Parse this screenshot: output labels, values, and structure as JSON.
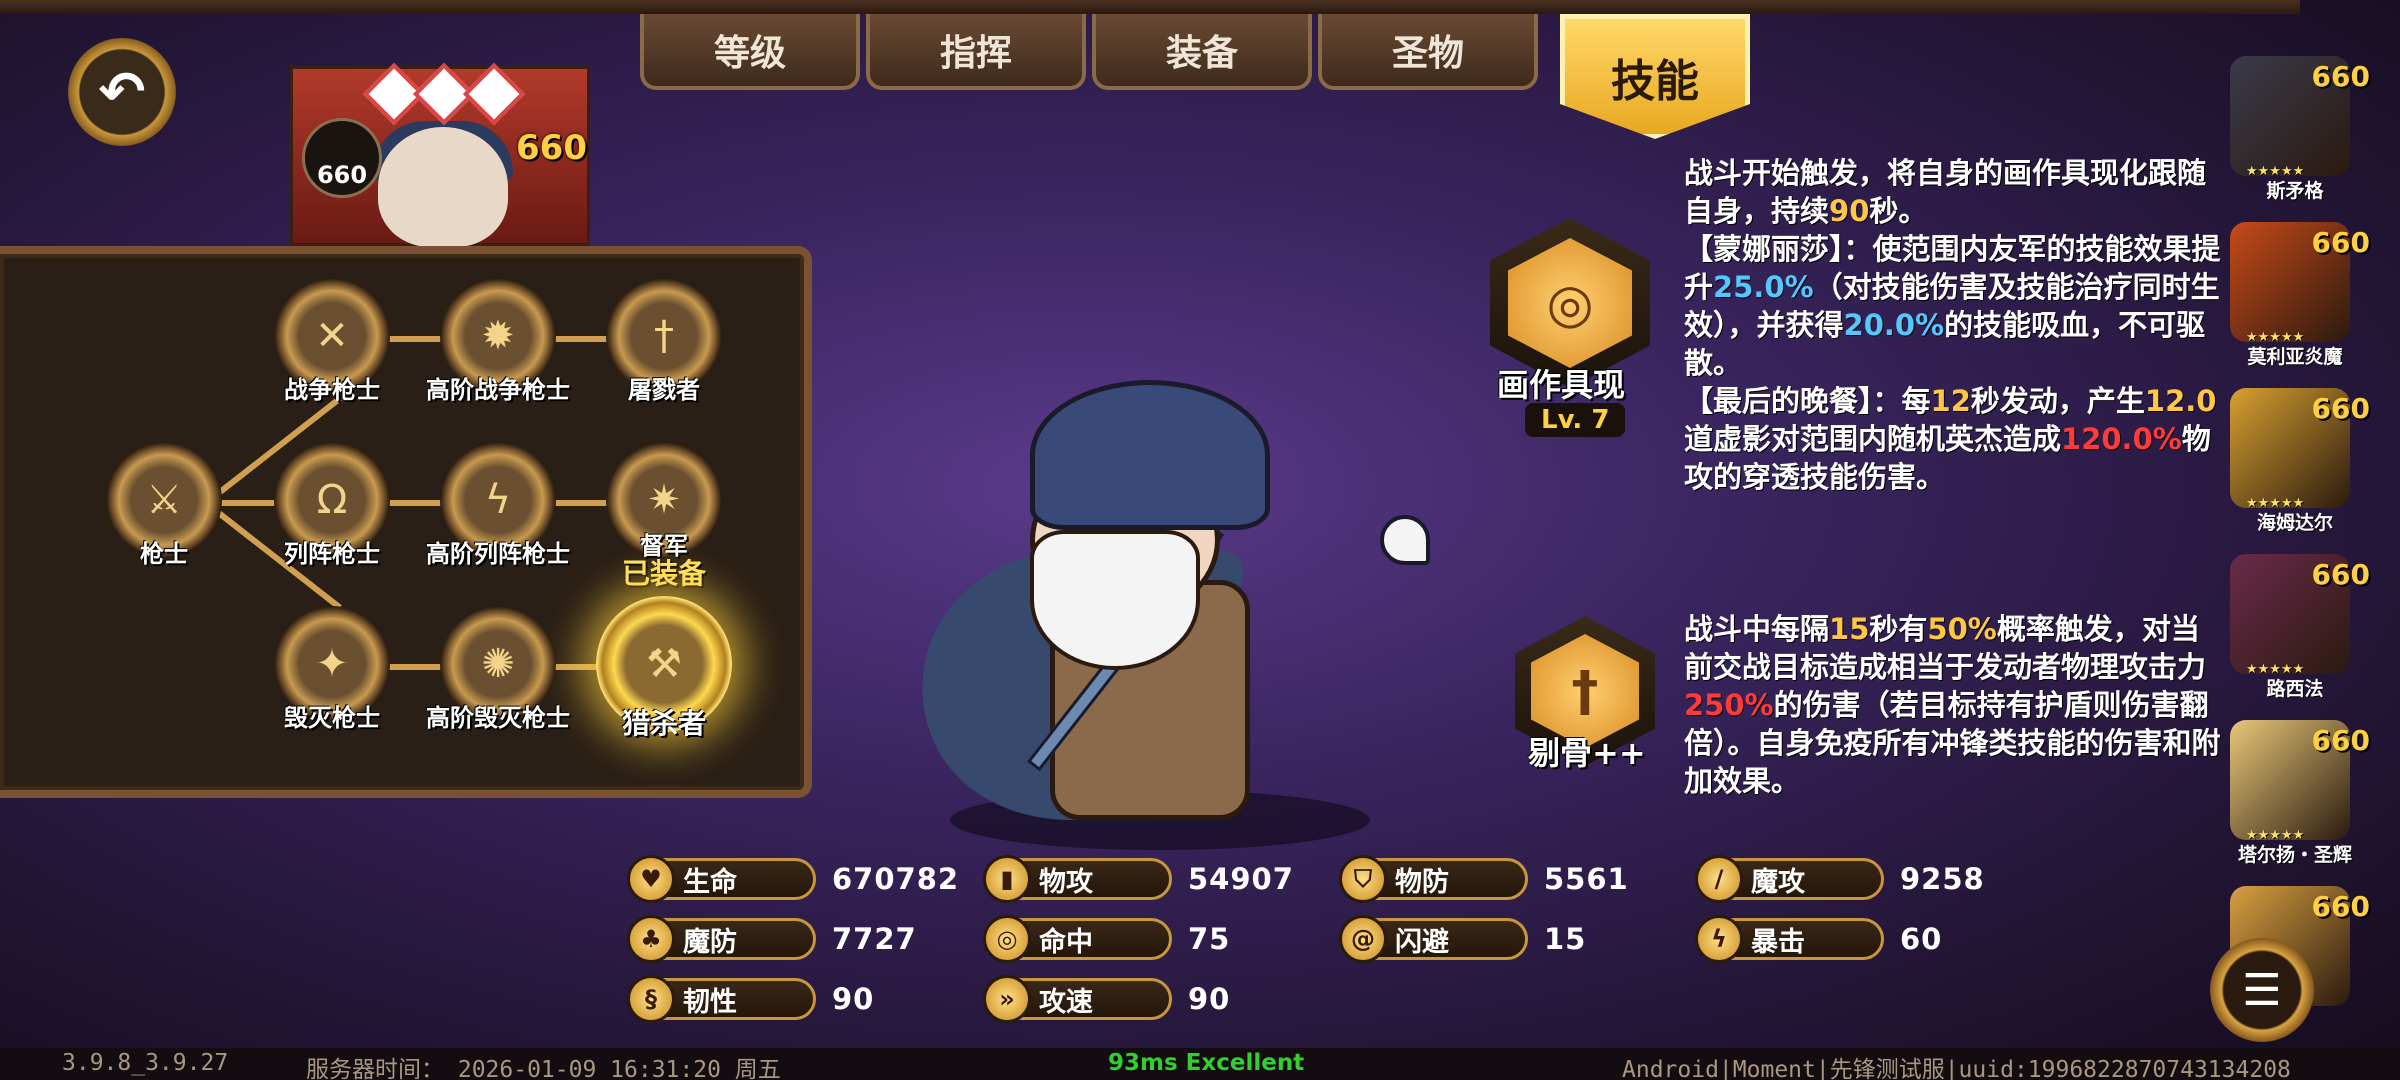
{
  "tabs": [
    {
      "label": "等级"
    },
    {
      "label": "指挥"
    },
    {
      "label": "装备"
    },
    {
      "label": "圣物"
    },
    {
      "label": "技能",
      "active": true
    }
  ],
  "portrait": {
    "level_left": "660",
    "level_right": "660"
  },
  "tree": {
    "nodes": [
      {
        "id": "qiangshi",
        "label": "枪士"
      },
      {
        "id": "zhanzheng",
        "label": "战争枪士"
      },
      {
        "id": "gaojie_zhanzheng",
        "label": "高阶战争枪士"
      },
      {
        "id": "tulu",
        "label": "屠戮者"
      },
      {
        "id": "liezhen",
        "label": "列阵枪士"
      },
      {
        "id": "gaojie_liezhen",
        "label": "高阶列阵枪士"
      },
      {
        "id": "dujun",
        "label": "督军"
      },
      {
        "id": "huimie",
        "label": "毁灭枪士"
      },
      {
        "id": "gaojie_huimie",
        "label": "高阶毁灭枪士"
      },
      {
        "id": "lieshazhe",
        "label": "猎杀者",
        "equipped": true
      }
    ],
    "equipped_tag": "已装备"
  },
  "skills": [
    {
      "name": "画作具现",
      "level": "Lv. 7",
      "icon": "swirl-painting-icon",
      "desc_parts": [
        {
          "t": "战斗开始触发，将自身的画作具现化跟随自身，持续"
        },
        {
          "t": "90",
          "c": "y"
        },
        {
          "t": "秒。\n【蒙娜丽莎】：使范围内友军的技能效果提升"
        },
        {
          "t": "25.0%",
          "c": "b"
        },
        {
          "t": "（对技能伤害及技能治疗同时生效），并获得"
        },
        {
          "t": "20.0%",
          "c": "b"
        },
        {
          "t": "的技能吸血，不可驱散。\n【最后的晚餐】：每"
        },
        {
          "t": "12",
          "c": "y"
        },
        {
          "t": "秒发动，产生"
        },
        {
          "t": "12.0",
          "c": "y"
        },
        {
          "t": "道虚影对范围内随机英杰造成"
        },
        {
          "t": "120.0%",
          "c": "r"
        },
        {
          "t": "物攻的穿透技能伤害。"
        }
      ]
    },
    {
      "name": "剔骨++",
      "icon": "cleaver-icon",
      "desc_parts": [
        {
          "t": "战斗中每隔"
        },
        {
          "t": "15",
          "c": "y"
        },
        {
          "t": "秒有"
        },
        {
          "t": "50%",
          "c": "y"
        },
        {
          "t": "概率触发，对当前交战目标造成相当于发动者物理攻击力"
        },
        {
          "t": "250%",
          "c": "r"
        },
        {
          "t": "的伤害（若目标持有护盾则伤害翻倍）。自身免疫所有冲锋类技能的伤害和附加效果。"
        }
      ]
    }
  ],
  "stats": [
    {
      "label": "生命",
      "value": "670782",
      "icon": "heart-icon"
    },
    {
      "label": "物攻",
      "value": "54907",
      "icon": "sword-icon"
    },
    {
      "label": "物防",
      "value": "5561",
      "icon": "shield-icon"
    },
    {
      "label": "魔攻",
      "value": "9258",
      "icon": "staff-icon"
    },
    {
      "label": "魔防",
      "value": "7727",
      "icon": "clover-icon"
    },
    {
      "label": "命中",
      "value": "75",
      "icon": "target-icon"
    },
    {
      "label": "闪避",
      "value": "15",
      "icon": "swirl-icon"
    },
    {
      "label": "暴击",
      "value": "60",
      "icon": "lightning-icon"
    },
    {
      "label": "韧性",
      "value": "90",
      "icon": "dna-icon"
    },
    {
      "label": "攻速",
      "value": "90",
      "icon": "speed-sword-icon"
    }
  ],
  "roster": [
    {
      "name": "斯矛格",
      "level": "660",
      "color": "#3a3a4a"
    },
    {
      "name": "莫利亚炎魔",
      "level": "660",
      "color": "#c84a18"
    },
    {
      "name": "海姆达尔",
      "level": "660",
      "color": "#d8a030"
    },
    {
      "name": "路西法",
      "level": "660",
      "color": "#6a2a4a"
    },
    {
      "name": "塔尔扬・圣辉",
      "level": "660",
      "color": "#e8c878"
    },
    {
      "name": "",
      "level": "660",
      "color": "#d8a040"
    }
  ],
  "footer": {
    "version": "3.9.8_3.9.27",
    "server_time": "服务器时间：  2026-01-09  16:31:20  周五",
    "ping": "93ms Excellent",
    "device": "Android|Moment|先锋测试服|uuid:1996822870743134208"
  },
  "colors": {
    "highlight_yellow": "#ffc840",
    "highlight_blue": "#52c8ff",
    "highlight_red": "#ff3a3a",
    "accent_gold": "#c8973a"
  }
}
